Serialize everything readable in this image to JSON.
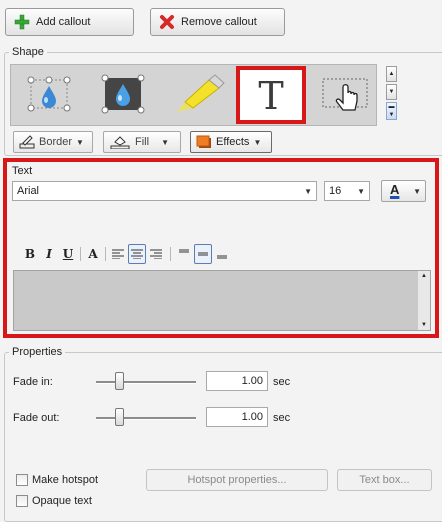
{
  "top_buttons": {
    "add_callout": "Add callout",
    "remove_callout": "Remove callout"
  },
  "shape_group": {
    "label": "Shape",
    "gallery": [
      {
        "name": "shape-balloon-outline",
        "icon": "drop-in-rectangle-icon"
      },
      {
        "name": "shape-balloon-filled",
        "icon": "drop-in-dark-rectangle-icon"
      },
      {
        "name": "shape-highlight",
        "icon": "highlighter-icon"
      },
      {
        "name": "shape-text",
        "icon": "text-T-icon",
        "selected": true
      },
      {
        "name": "shape-hotspot",
        "icon": "hand-cursor-icon"
      }
    ],
    "border_label": "Border",
    "fill_label": "Fill",
    "effects_label": "Effects"
  },
  "text_group": {
    "label": "Text",
    "font": "Arial",
    "size": "16",
    "font_color_glyph": "A"
  },
  "properties_group": {
    "label": "Properties",
    "fade_in_label": "Fade in:",
    "fade_in_value": "1.00",
    "fade_out_label": "Fade out:",
    "fade_out_value": "1.00",
    "unit": "sec",
    "make_hotspot_label": "Make hotspot",
    "hotspot_properties_label": "Hotspot properties...",
    "text_box_label": "Text box...",
    "opaque_text_label": "Opaque text"
  },
  "colors": {
    "highlight_red": "#d81818",
    "gallery_bg": "#d4d4d4"
  }
}
